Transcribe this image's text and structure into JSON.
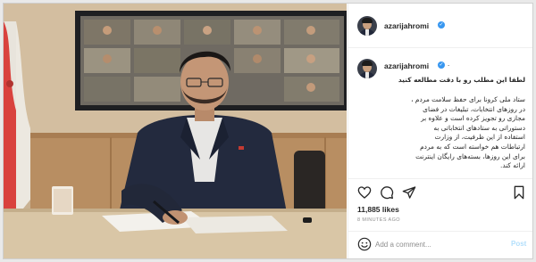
{
  "post": {
    "username": "azarijahromi",
    "separator": ".",
    "caption_first": "لطفا این مطلب رو با دقت مطالعه کنید",
    "caption_lines": [
      "ستاد ملی کرونا برای حفظ سلامت مردم ،",
      "در روزهای انتخابات، تبلیغات در فضای",
      "مجازی رو تجویز کرده است و علاوه بر",
      "دستوراتی به ستادهای انتخاباتی به",
      "استفاده از این ظرفیت، از وزارت",
      "ارتباطات هم خواسته است که به مردم",
      "برای این روزها، بسته‌های رایگان اینترنت",
      "ارائه کند."
    ],
    "likes": "11,885 likes",
    "time_ago": "8 MINUTES AGO"
  },
  "comment": {
    "placeholder": "Add a comment...",
    "post_label": "Post"
  },
  "icons": {
    "like": "heart-icon",
    "comment": "comment-icon",
    "share": "send-icon",
    "save": "bookmark-icon",
    "emoji": "smiley-icon",
    "verified": "verified-badge-icon"
  },
  "colors": {
    "link_blue": "#3897f0",
    "post_button_disabled": "#b2dffc",
    "muted_text": "#8e8e8e",
    "text": "#262626"
  }
}
